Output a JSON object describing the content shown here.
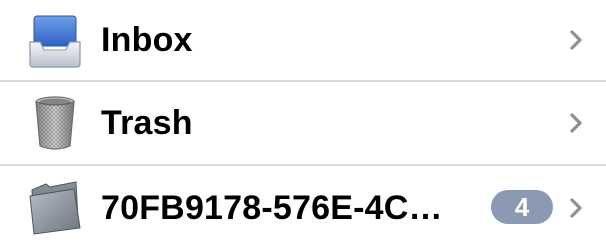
{
  "mailboxes": [
    {
      "label": "Inbox",
      "icon": "inbox-tray-icon",
      "badge": ""
    },
    {
      "label": "Trash",
      "icon": "trash-can-icon",
      "badge": ""
    },
    {
      "label": "70FB9178-576E-4C…",
      "icon": "folder-icon",
      "badge": "4"
    }
  ],
  "colors": {
    "badge_background": "#8c99b3",
    "chevron": "#8e8e8e",
    "separator": "#d9d9d9"
  }
}
